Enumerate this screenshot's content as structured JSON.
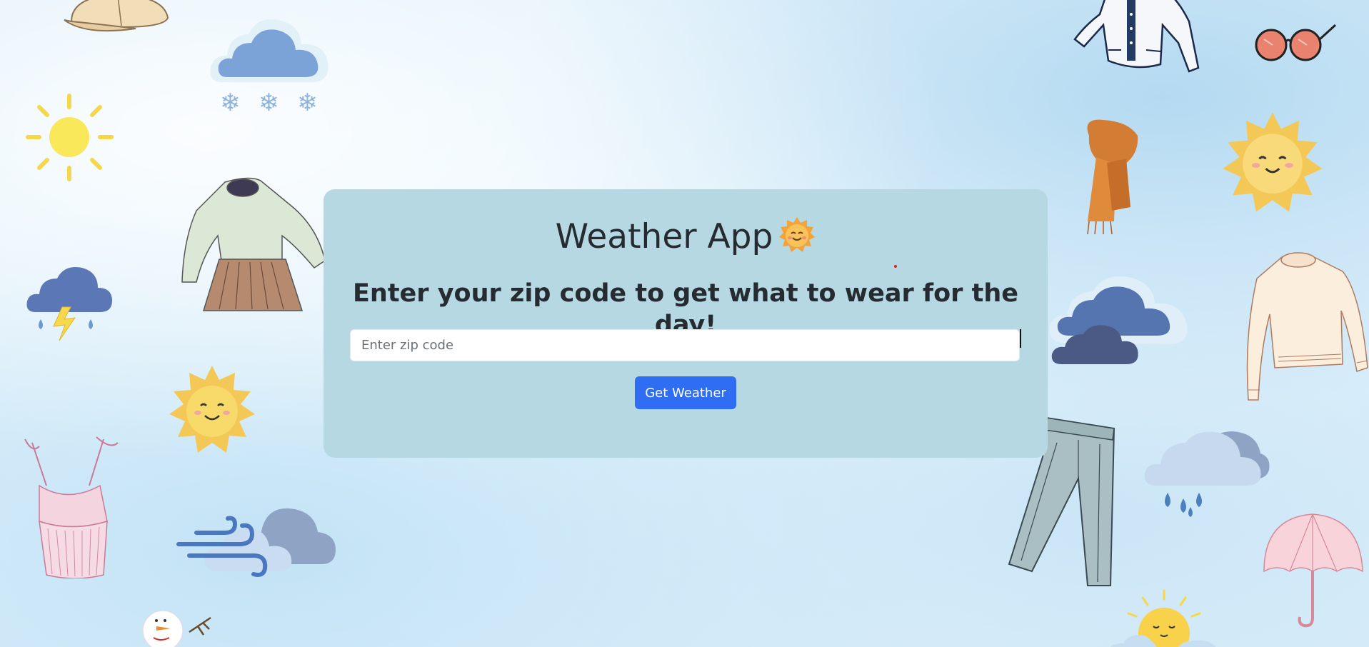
{
  "app": {
    "title": "Weather App",
    "title_emoji": "smiling-sun",
    "subtitle": "Enter your zip code to get what to wear for the day!"
  },
  "form": {
    "zip_placeholder": "Enter zip code",
    "zip_value": "",
    "submit_label": "Get Weather"
  },
  "colors": {
    "card_bg": "#b6d8e3",
    "button_bg": "#2f6df3",
    "text": "#262b31"
  },
  "decorations": [
    "cap-icon",
    "snow-cloud-icon",
    "sun-icon",
    "sweater-skirt-outfit-icon",
    "thunder-cloud-icon",
    "smiling-sun-icon",
    "tank-top-icon",
    "wind-cloud-icon",
    "snowman-icon",
    "jacket-icon",
    "sunglasses-icon",
    "scarf-icon",
    "smiling-sun-icon",
    "cloud-icon",
    "cream-sweater-icon",
    "jeans-icon",
    "rain-cloud-icon",
    "umbrella-icon",
    "sleepy-sun-cloud-icon"
  ]
}
